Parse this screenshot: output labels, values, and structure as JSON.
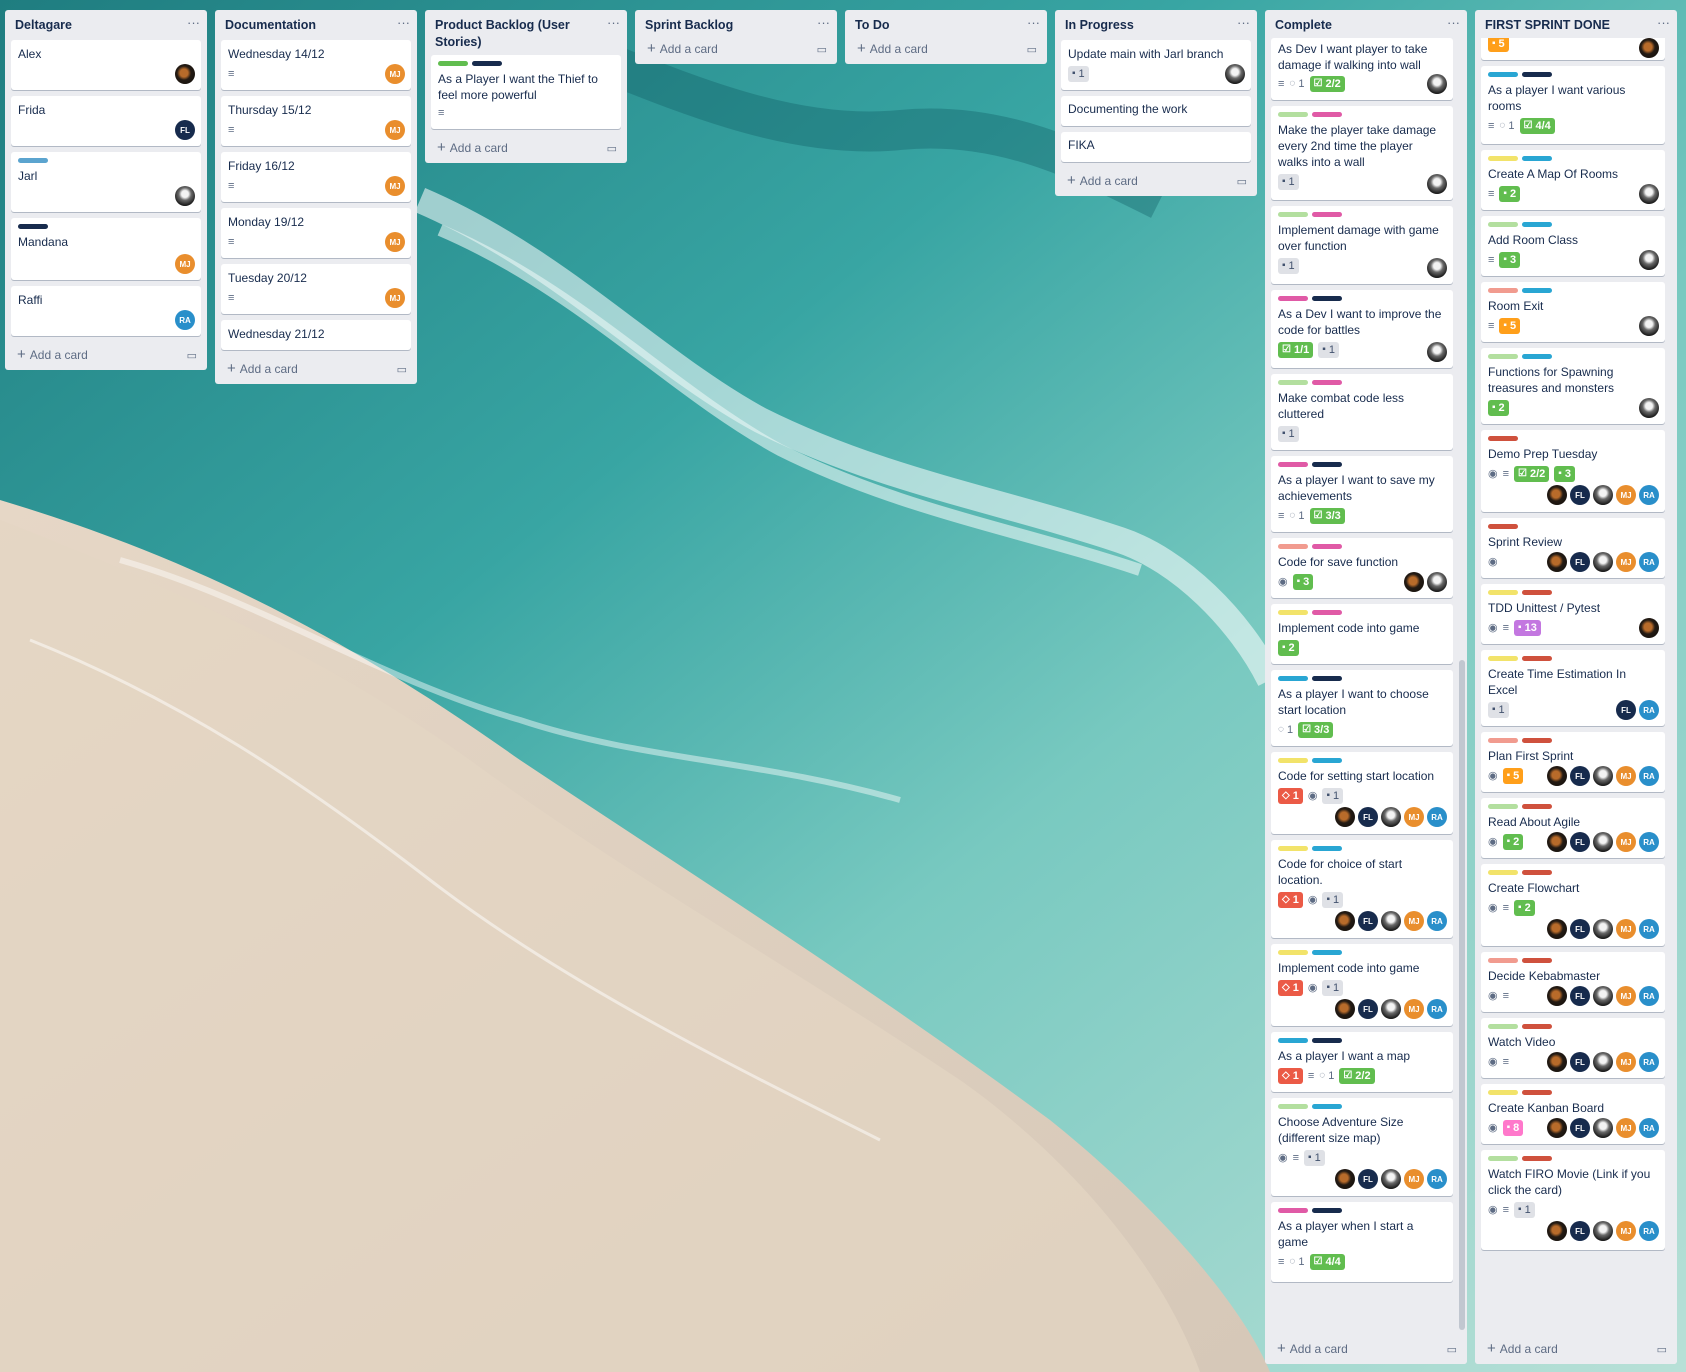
{
  "add_card_label": "Add a card",
  "label_colors": {
    "blue": "#29a6d3",
    "navy": "#172b4d",
    "green": "#61bd4f",
    "lgreen": "#b3df9f",
    "pink": "#e05aa6",
    "yellow": "#f2e36a",
    "red": "#cf513d",
    "salmon": "#f19b8f",
    "skyblue": "#5ba4cf"
  },
  "lists": {
    "deltagare": {
      "title": "Deltagare",
      "cards": [
        {
          "title": "Alex"
        },
        {
          "title": "Frida"
        },
        {
          "title": "Jarl"
        },
        {
          "title": "Mandana"
        },
        {
          "title": "Raffi"
        }
      ]
    },
    "documentation": {
      "title": "Documentation",
      "cards": [
        {
          "title": "Wednesday 14/12"
        },
        {
          "title": "Thursday 15/12"
        },
        {
          "title": "Friday 16/12"
        },
        {
          "title": "Monday 19/12"
        },
        {
          "title": "Tuesday 20/12"
        },
        {
          "title": "Wednesday 21/12"
        }
      ]
    },
    "product_backlog": {
      "title": "Product Backlog (User Stories)",
      "cards": [
        {
          "title": "As a Player I want the Thief to feel more powerful"
        }
      ]
    },
    "sprint_backlog": {
      "title": "Sprint Backlog"
    },
    "todo": {
      "title": "To Do"
    },
    "in_progress": {
      "title": "In Progress",
      "cards": [
        {
          "title": "Update main with Jarl branch",
          "checklist": "1"
        },
        {
          "title": "Documenting the work"
        },
        {
          "title": "FIKA"
        }
      ]
    },
    "complete": {
      "title": "Complete",
      "cards": [
        {
          "title": "As Dev I want player to take damage if walking into wall",
          "comments": "1",
          "checklist": "2/2"
        },
        {
          "title": "Make the player take damage every 2nd time the player walks into a wall",
          "checklist": "1"
        },
        {
          "title": "Implement damage with game over function",
          "checklist": "1"
        },
        {
          "title": "As a Dev I want to improve the code for battles",
          "checkitems": "1/1",
          "checklist": "1"
        },
        {
          "title": "Make combat code less cluttered",
          "checklist": "1"
        },
        {
          "title": "As a player I want to save my achievements",
          "comments": "1",
          "checkitems": "3/3"
        },
        {
          "title": "Code for save function",
          "checklist": "3"
        },
        {
          "title": "Implement code into game",
          "checklist": "2"
        },
        {
          "title": "As a player I want to choose start location",
          "comments": "1",
          "checkitems": "3/3"
        },
        {
          "title": "Code for setting start location",
          "votes": "1",
          "checklist": "1"
        },
        {
          "title": "Code for choice of start location.",
          "votes": "1",
          "checklist": "1"
        },
        {
          "title": "Implement code into game",
          "votes": "1",
          "checklist": "1"
        },
        {
          "title": "As a player I want a map",
          "votes": "1",
          "comments": "1",
          "checkitems": "2/2"
        },
        {
          "title": "Choose Adventure Size (different size map)",
          "checklist": "1"
        },
        {
          "title": "As a player when I start a game",
          "comments": "1",
          "checkitems": "4/4"
        }
      ]
    },
    "first_sprint_done": {
      "title": "FIRST SPRINT DONE",
      "cards": [
        {
          "title": "",
          "points": "5"
        },
        {
          "title": "As a player I want various rooms",
          "comments": "1",
          "checkitems": "4/4"
        },
        {
          "title": "Create A Map Of Rooms",
          "points": "2"
        },
        {
          "title": "Add Room Class",
          "points": "3"
        },
        {
          "title": "Room Exit",
          "points": "5"
        },
        {
          "title": "Functions for Spawning treasures and monsters",
          "points": "2"
        },
        {
          "title": "Demo Prep Tuesday",
          "checkitems": "2/2",
          "points": "3"
        },
        {
          "title": "Sprint Review"
        },
        {
          "title": "TDD Unittest / Pytest",
          "points": "13"
        },
        {
          "title": "Create Time Estimation In Excel",
          "checklist": "1"
        },
        {
          "title": "Plan First Sprint",
          "points": "5"
        },
        {
          "title": "Read About Agile",
          "points": "2"
        },
        {
          "title": "Create Flowchart",
          "points": "2"
        },
        {
          "title": "Decide Kebabmaster"
        },
        {
          "title": "Watch Video"
        },
        {
          "title": "Create Kanban Board",
          "points": "8"
        },
        {
          "title": "Watch FIRO Movie (Link if you click the card)",
          "checklist": "1"
        }
      ]
    }
  },
  "avatars": {
    "fl": "FL",
    "mj": "MJ",
    "ra": "RA"
  }
}
